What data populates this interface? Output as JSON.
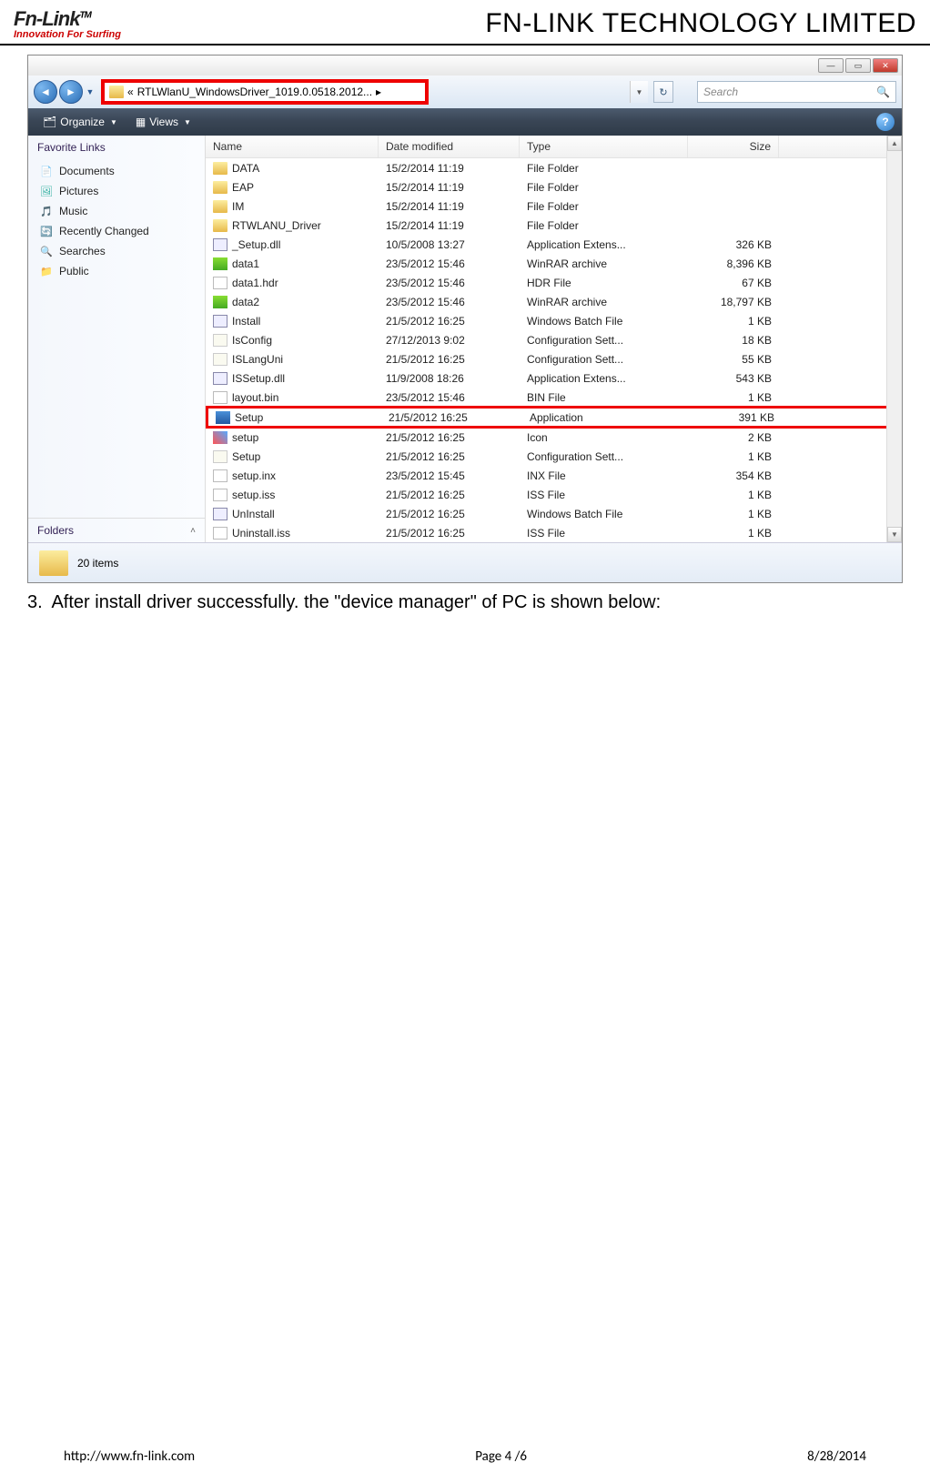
{
  "header": {
    "logo_main": "Fn-Link",
    "logo_tm": "TM",
    "logo_tag": "Innovation For Surfing",
    "company": "FN-LINK TECHNOLOGY LIMITED"
  },
  "window": {
    "address_prefix": "«",
    "address_path": "RTLWlanU_WindowsDriver_1019.0.0518.2012...",
    "address_arrow": "▸",
    "search_placeholder": "Search",
    "toolbar": {
      "organize": "Organize",
      "views": "Views"
    },
    "sidebar": {
      "fav_head": "Favorite Links",
      "items": [
        {
          "icon": "doc",
          "label": "Documents"
        },
        {
          "icon": "pic",
          "label": "Pictures"
        },
        {
          "icon": "mus",
          "label": "Music"
        },
        {
          "icon": "rc",
          "label": "Recently Changed"
        },
        {
          "icon": "sr",
          "label": "Searches"
        },
        {
          "icon": "pub",
          "label": "Public"
        }
      ],
      "folders_head": "Folders"
    },
    "columns": {
      "name": "Name",
      "date": "Date modified",
      "type": "Type",
      "size": "Size"
    },
    "files": [
      {
        "icon": "folder",
        "name": "DATA",
        "date": "15/2/2014 11:19",
        "type": "File Folder",
        "size": "",
        "hl": false
      },
      {
        "icon": "folder",
        "name": "EAP",
        "date": "15/2/2014 11:19",
        "type": "File Folder",
        "size": "",
        "hl": false
      },
      {
        "icon": "folder",
        "name": "IM",
        "date": "15/2/2014 11:19",
        "type": "File Folder",
        "size": "",
        "hl": false
      },
      {
        "icon": "folder",
        "name": "RTWLANU_Driver",
        "date": "15/2/2014 11:19",
        "type": "File Folder",
        "size": "",
        "hl": false
      },
      {
        "icon": "dll",
        "name": "_Setup.dll",
        "date": "10/5/2008 13:27",
        "type": "Application Extens...",
        "size": "326 KB",
        "hl": false
      },
      {
        "icon": "rar",
        "name": "data1",
        "date": "23/5/2012 15:46",
        "type": "WinRAR archive",
        "size": "8,396 KB",
        "hl": false
      },
      {
        "icon": "file",
        "name": "data1.hdr",
        "date": "23/5/2012 15:46",
        "type": "HDR File",
        "size": "67 KB",
        "hl": false
      },
      {
        "icon": "rar",
        "name": "data2",
        "date": "23/5/2012 15:46",
        "type": "WinRAR archive",
        "size": "18,797 KB",
        "hl": false
      },
      {
        "icon": "bat",
        "name": "Install",
        "date": "21/5/2012 16:25",
        "type": "Windows Batch File",
        "size": "1 KB",
        "hl": false
      },
      {
        "icon": "ini",
        "name": "IsConfig",
        "date": "27/12/2013 9:02",
        "type": "Configuration Sett...",
        "size": "18 KB",
        "hl": false
      },
      {
        "icon": "ini",
        "name": "ISLangUni",
        "date": "21/5/2012 16:25",
        "type": "Configuration Sett...",
        "size": "55 KB",
        "hl": false
      },
      {
        "icon": "dll",
        "name": "ISSetup.dll",
        "date": "11/9/2008 18:26",
        "type": "Application Extens...",
        "size": "543 KB",
        "hl": false
      },
      {
        "icon": "file",
        "name": "layout.bin",
        "date": "23/5/2012 15:46",
        "type": "BIN File",
        "size": "1 KB",
        "hl": false
      },
      {
        "icon": "exe",
        "name": "Setup",
        "date": "21/5/2012 16:25",
        "type": "Application",
        "size": "391 KB",
        "hl": true
      },
      {
        "icon": "ico",
        "name": "setup",
        "date": "21/5/2012 16:25",
        "type": "Icon",
        "size": "2 KB",
        "hl": false
      },
      {
        "icon": "ini",
        "name": "Setup",
        "date": "21/5/2012 16:25",
        "type": "Configuration Sett...",
        "size": "1 KB",
        "hl": false
      },
      {
        "icon": "file",
        "name": "setup.inx",
        "date": "23/5/2012 15:45",
        "type": "INX File",
        "size": "354 KB",
        "hl": false
      },
      {
        "icon": "file",
        "name": "setup.iss",
        "date": "21/5/2012 16:25",
        "type": "ISS File",
        "size": "1 KB",
        "hl": false
      },
      {
        "icon": "bat",
        "name": "UnInstall",
        "date": "21/5/2012 16:25",
        "type": "Windows Batch File",
        "size": "1 KB",
        "hl": false
      },
      {
        "icon": "file",
        "name": "Uninstall.iss",
        "date": "21/5/2012 16:25",
        "type": "ISS File",
        "size": "1 KB",
        "hl": false
      }
    ],
    "status": "20 items"
  },
  "step": {
    "num": "3.",
    "text": "After install driver successfully. the \"device manager\" of PC is shown below:"
  },
  "footer": {
    "url": "http://www.fn-link.com",
    "page": "Page 4 /6",
    "date": "8/28/2014"
  }
}
